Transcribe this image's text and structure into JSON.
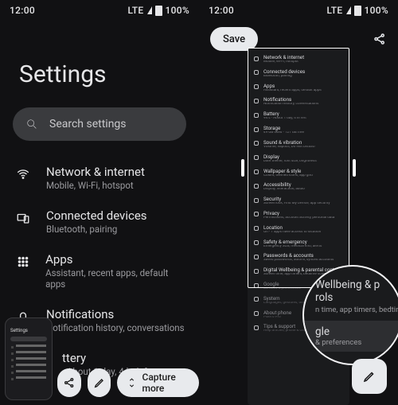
{
  "status": {
    "time": "12:00",
    "lte": "LTE",
    "battery": "100%"
  },
  "left": {
    "title": "Settings",
    "search_placeholder": "Search settings",
    "items": [
      {
        "title": "Network & internet",
        "sub": "Mobile, Wi-Fi, hotspot"
      },
      {
        "title": "Connected devices",
        "sub": "Bluetooth, pairing"
      },
      {
        "title": "Apps",
        "sub": "Assistant, recent apps, default apps"
      },
      {
        "title": "Notifications",
        "sub": "Notification history, conversations"
      },
      {
        "title": "ttery",
        "sub": "· About 1 day, 4 hr left"
      }
    ],
    "capture_more": "Capture more"
  },
  "right": {
    "save": "Save",
    "mini": [
      {
        "t": "Network & internet",
        "s": "Mobile, Wi-Fi, hotspot"
      },
      {
        "t": "Connected devices",
        "s": "Bluetooth, pairing"
      },
      {
        "t": "Apps",
        "s": "Assistant, recent apps, default apps"
      },
      {
        "t": "Notifications",
        "s": "Notification history, conversations"
      },
      {
        "t": "Battery",
        "s": "94% - About 1 day, 4 hr left"
      },
      {
        "t": "Storage",
        "s": "49 GB used - 121 GB free"
      },
      {
        "t": "Sound & vibration",
        "s": "Volume, haptics, Do Not Disturb"
      },
      {
        "t": "Display",
        "s": "Dark theme, font size, brightness"
      },
      {
        "t": "Wallpaper & style",
        "s": "Colors, themed icons, app grid"
      },
      {
        "t": "Accessibility",
        "s": "Display, interaction, audio"
      },
      {
        "t": "Security",
        "s": "Screen lock, Find My Device, app security"
      },
      {
        "t": "Privacy",
        "s": "Permissions, account activity, personal data"
      },
      {
        "t": "Location",
        "s": "On - 7 apps have access to location"
      },
      {
        "t": "Safety & emergency",
        "s": "Emergency SOS, medical info, alerts"
      },
      {
        "t": "Passwords & accounts",
        "s": "Saved passwords, autofill, synced accounts"
      },
      {
        "t": "Digital Wellbeing & parental controls",
        "s": "Screen time, app timers, bedtime schedules"
      },
      {
        "t": "Google",
        "s": "Services & preferences"
      },
      {
        "t": "System",
        "s": "Languages, gestures, time, backup"
      },
      {
        "t": "About phone",
        "s": "Pixel 6 Pro"
      },
      {
        "t": "Tips & support",
        "s": "Help articles, phone & chat"
      }
    ],
    "lens": {
      "l1": "Wellbeing & p",
      "l2": "rols",
      "l3": "n time, app timers, bedtim",
      "b1": "gle",
      "b2": "& preferences"
    }
  }
}
